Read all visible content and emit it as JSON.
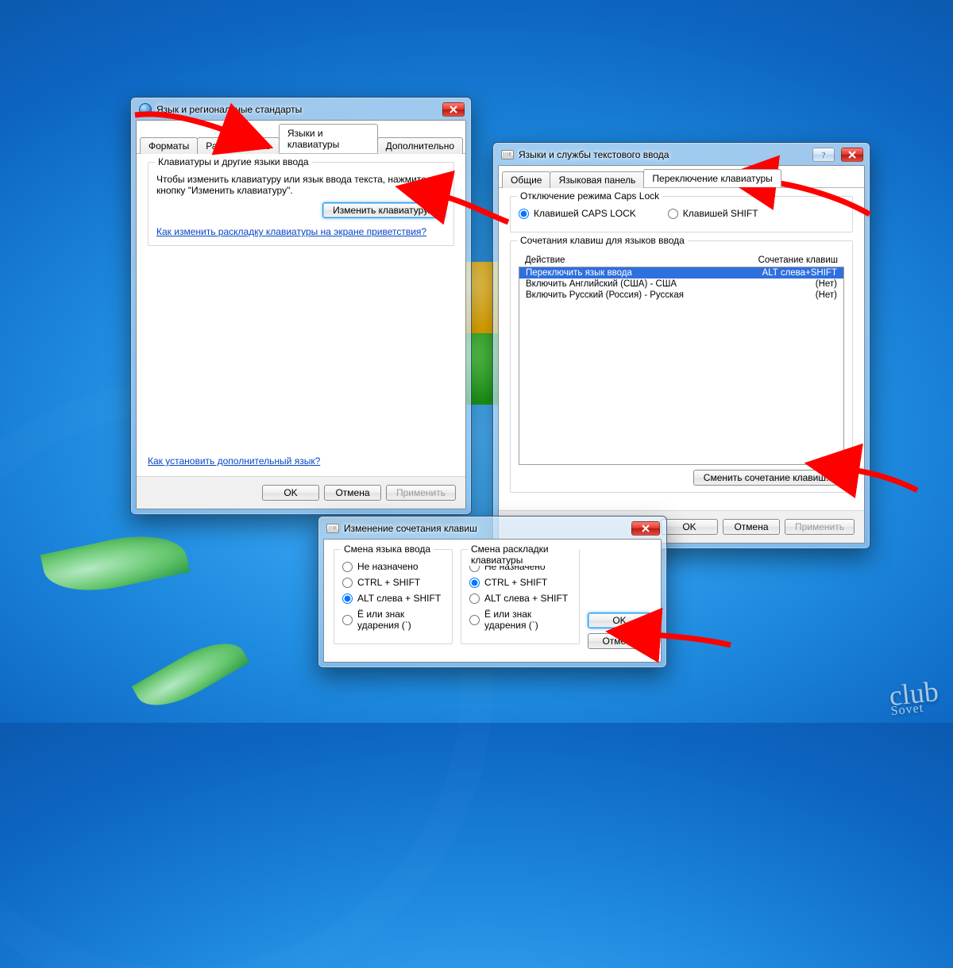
{
  "watermark": {
    "top": "club",
    "bottom": "Sovet"
  },
  "dlg1": {
    "title": "Язык и региональные стандарты",
    "tabs": [
      "Форматы",
      "Расположение",
      "Языки и клавиатуры",
      "Дополнительно"
    ],
    "active_tab": 2,
    "group_title": "Клавиатуры и другие языки ввода",
    "desc": "Чтобы изменить клавиатуру или язык ввода текста, нажмите кнопку \"Изменить клавиатуру\".",
    "change_kb": "Изменить клавиатуру...",
    "link1": "Как изменить раскладку клавиатуры на экране приветствия?",
    "link2": "Как установить дополнительный язык?",
    "ok": "OK",
    "cancel": "Отмена",
    "apply": "Применить"
  },
  "dlg2": {
    "title": "Языки и службы текстового ввода",
    "tabs": [
      "Общие",
      "Языковая панель",
      "Переключение клавиатуры"
    ],
    "active_tab": 2,
    "caps_group": "Отключение режима Caps Lock",
    "caps_opt1": "Клавишей CAPS LOCK",
    "caps_opt2": "Клавишей SHIFT",
    "hk_group": "Сочетания клавиш для языков ввода",
    "hk_col1": "Действие",
    "hk_col2": "Сочетание клавиш",
    "hk_rows": [
      {
        "action": "Переключить язык ввода",
        "keys": "ALT слева+SHIFT",
        "selected": true
      },
      {
        "action": "Включить Английский (США) - США",
        "keys": "(Нет)",
        "selected": false
      },
      {
        "action": "Включить Русский (Россия) - Русская",
        "keys": "(Нет)",
        "selected": false
      }
    ],
    "change_btn": "Сменить сочетание клавиш...",
    "ok": "OK",
    "cancel": "Отмена",
    "apply": "Применить"
  },
  "dlg3": {
    "title": "Изменение сочетания клавиш",
    "left_group": "Смена языка ввода",
    "right_group": "Смена раскладки клавиатуры",
    "opt_none": "Не назначено",
    "opt_ctrl": "CTRL + SHIFT",
    "opt_alt": "ALT слева + SHIFT",
    "opt_e": "Ё или знак ударения (`)",
    "ok": "OK",
    "cancel": "Отмена"
  }
}
